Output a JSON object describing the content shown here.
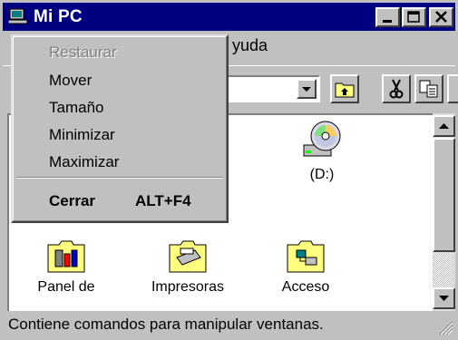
{
  "window": {
    "title": "Mi PC"
  },
  "menubar": {
    "partial_item": "yuda"
  },
  "system_menu": {
    "items": [
      {
        "label": "Restaurar",
        "enabled": false
      },
      {
        "label": "Mover",
        "enabled": true
      },
      {
        "label": "Tamaño",
        "enabled": true
      },
      {
        "label": "Minimizar",
        "enabled": true
      },
      {
        "label": "Maximizar",
        "enabled": true
      }
    ],
    "close": {
      "label": "Cerrar",
      "shortcut": "ALT+F4"
    }
  },
  "content": {
    "items": [
      {
        "label": "(D:)",
        "icon": "cd-drive-icon"
      },
      {
        "label": "Panel de",
        "icon": "control-panel-folder-icon"
      },
      {
        "label": "Impresoras",
        "icon": "printers-folder-icon"
      },
      {
        "label": "Acceso",
        "icon": "dialup-folder-icon"
      }
    ]
  },
  "statusbar": {
    "text": "Contiene comandos para manipular ventanas."
  },
  "colors": {
    "titlebar": "#000080",
    "face": "#c0c0c0",
    "window": "#ffffff",
    "disabled_text": "#808080"
  }
}
